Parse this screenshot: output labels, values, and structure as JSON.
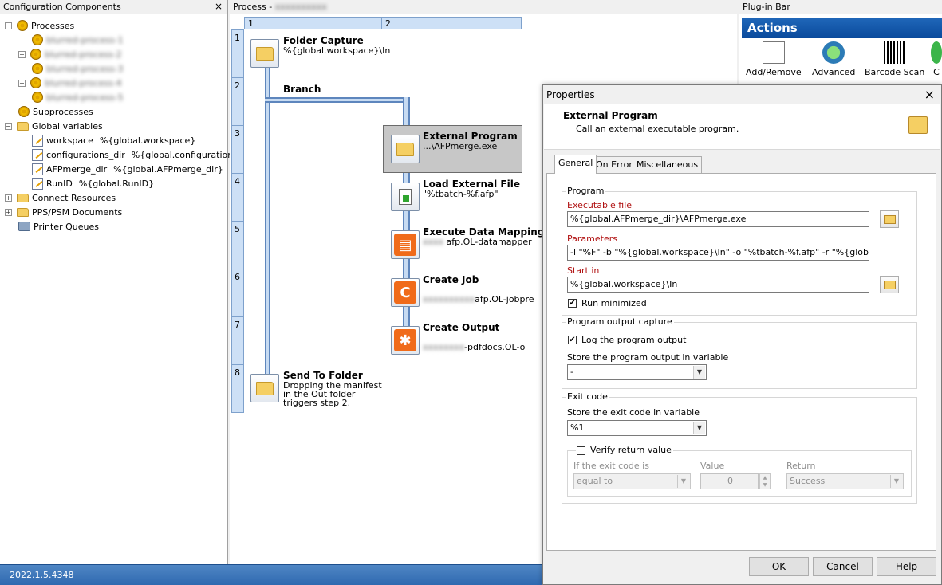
{
  "left_pane": {
    "title": "Configuration Components",
    "close_glyph": "×",
    "tree": {
      "processes": "Processes",
      "process_items": [
        "blurred-process-1",
        "blurred-process-2",
        "blurred-process-3",
        "blurred-process-4",
        "blurred-process-5"
      ],
      "subprocesses": "Subprocesses",
      "global_variables": "Global variables",
      "variables": [
        {
          "name": "workspace",
          "value": "%{global.workspace}"
        },
        {
          "name": "configurations_dir",
          "value": "%{global.configurations_dir}"
        },
        {
          "name": "AFPmerge_dir",
          "value": "%{global.AFPmerge_dir}"
        },
        {
          "name": "RunID",
          "value": "%{global.RunID}"
        }
      ],
      "connect_resources": "Connect Resources",
      "pps_psm": "PPS/PSM Documents",
      "printer_queues": "Printer Queues"
    }
  },
  "process_pane": {
    "title": "Process - ",
    "col1": "1",
    "col2": "2",
    "rows": [
      "1",
      "2",
      "3",
      "4",
      "5",
      "6",
      "7",
      "8"
    ],
    "steps": {
      "folder_capture": {
        "title": "Folder Capture",
        "sub": "%{global.workspace}\\In"
      },
      "branch": {
        "title": "Branch"
      },
      "external_program": {
        "title": "External Program",
        "sub": "...\\AFPmerge.exe"
      },
      "load_external_file": {
        "title": "Load External File",
        "sub": "\"%tbatch-%f.afp\""
      },
      "execute_data_mapping": {
        "title": "Execute Data Mapping",
        "sub": "afp.OL-datamapper"
      },
      "create_job": {
        "title": "Create Job",
        "sub": "afp.OL-jobpre"
      },
      "create_output": {
        "title": "Create Output",
        "sub": "-pdfdocs.OL-o"
      },
      "send_to_folder": {
        "title": "Send To Folder",
        "sub": "Dropping the manifest in the Out folder triggers step 2."
      }
    }
  },
  "plugin_bar": {
    "title": "Plug-in Bar",
    "actions_header": "Actions",
    "actions": [
      "Add/Remove",
      "Advanced",
      "Barcode Scan",
      "C"
    ]
  },
  "status_bar": {
    "version": "2022.1.5.4348"
  },
  "dialog": {
    "title": "Properties",
    "close_glyph": "×",
    "header_title": "External Program",
    "header_desc": "Call an external executable program.",
    "tabs": [
      "General",
      "On Error",
      "Miscellaneous"
    ],
    "program_group": "Program",
    "exe_label": "Executable file",
    "exe_value": "%{global.AFPmerge_dir}\\AFPmerge.exe",
    "params_label": "Parameters",
    "params_value": "-l \"%F\" -b \"%{global.workspace}\\In\" -o \"%tbatch-%f.afp\" -r \"%{global.configurati",
    "startin_label": "Start in",
    "startin_value": "%{global.workspace}\\In",
    "run_minimized": "Run minimized",
    "output_group": "Program output capture",
    "log_output": "Log the program output",
    "store_output_label": "Store the program output in variable",
    "store_output_value": "-",
    "exit_group": "Exit code",
    "store_exit_label": "Store the exit code in variable",
    "store_exit_value": "%1",
    "verify_label": "Verify return value",
    "if_exit_label": "If the exit code is",
    "if_exit_value": "equal to",
    "value_label": "Value",
    "value_value": "0",
    "return_label": "Return",
    "return_value": "Success",
    "ok": "OK",
    "cancel": "Cancel",
    "help": "Help",
    "check_glyph": "✔"
  }
}
